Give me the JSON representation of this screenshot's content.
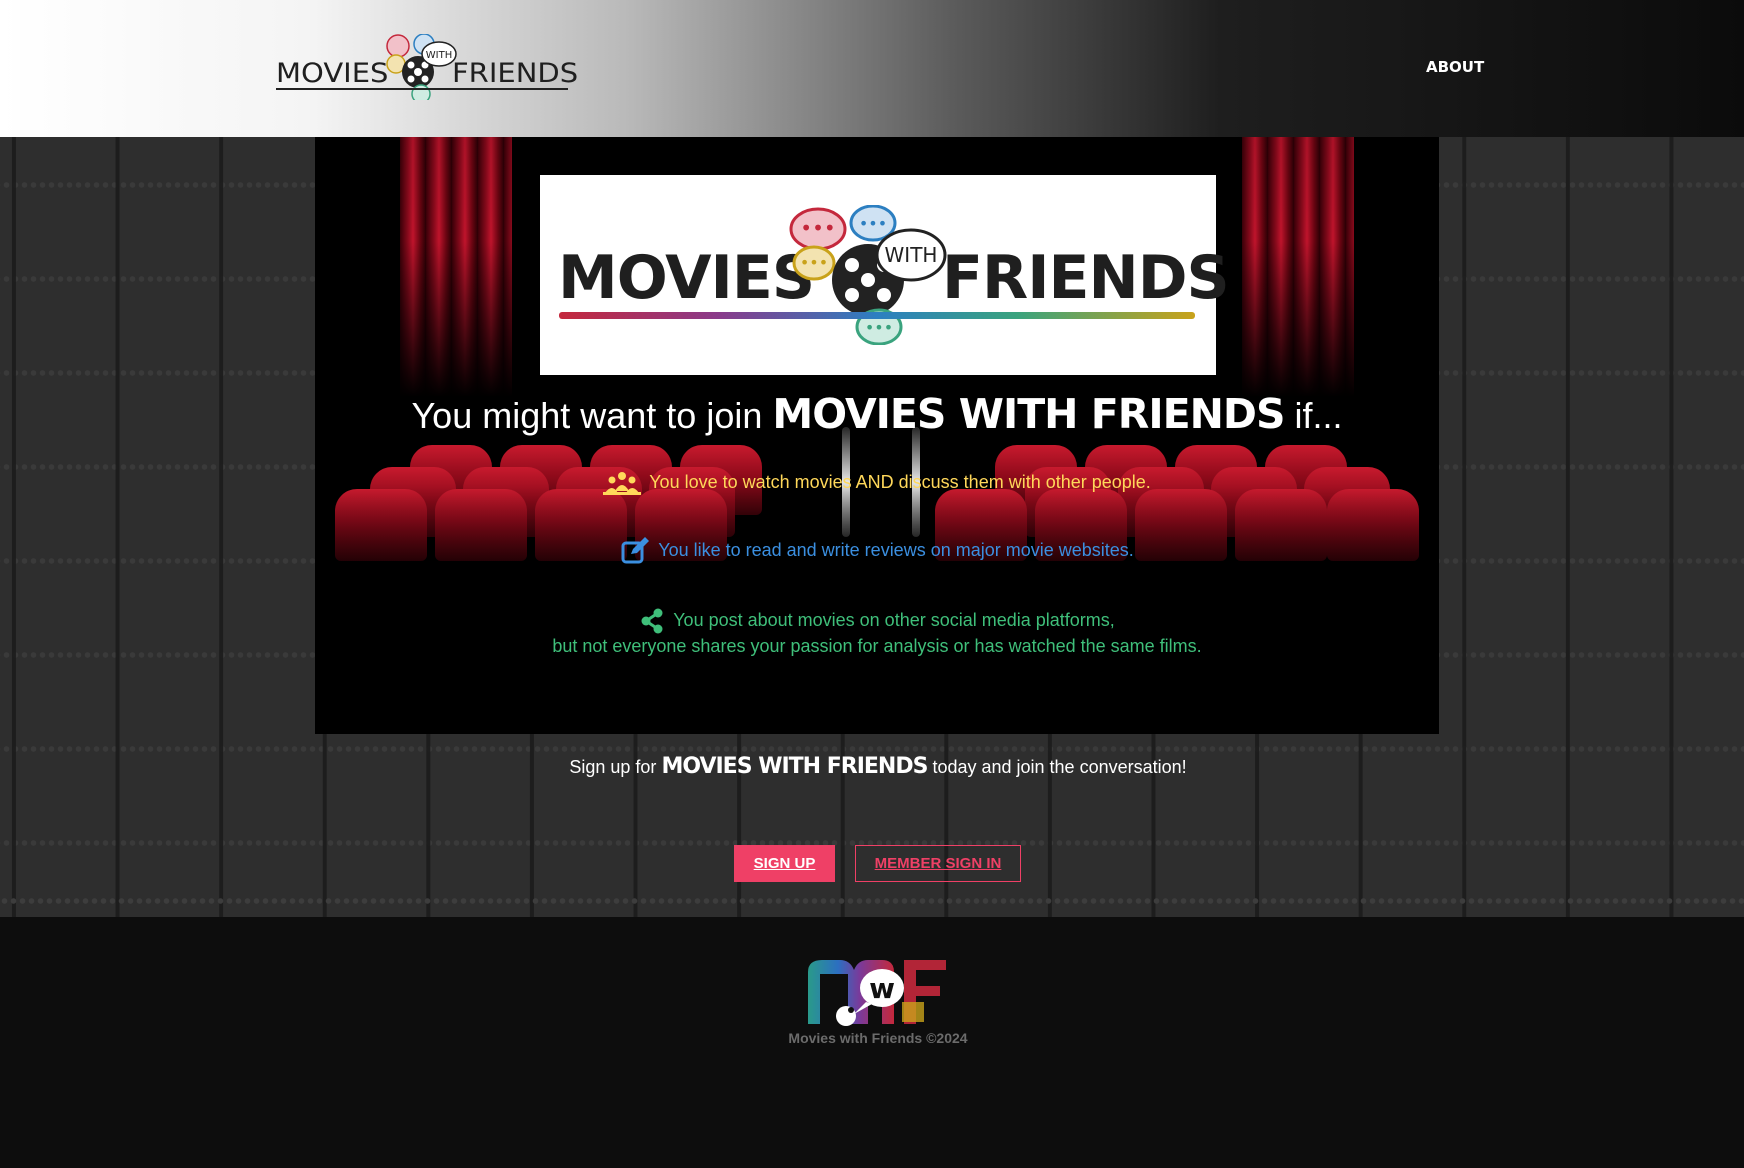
{
  "header": {
    "logo": {
      "word_left": "MOVIES",
      "word_mid": "WITH",
      "word_right": "FRIENDS"
    },
    "nav": {
      "about": "ABOUT"
    }
  },
  "hero": {
    "screen_logo": {
      "word_left": "MOVIES",
      "word_mid": "WITH",
      "word_right": "FRIENDS"
    },
    "headline": {
      "prefix": "You might want to join",
      "brand": "MOVIES WITH FRIENDS",
      "suffix": "if..."
    },
    "reasons": [
      {
        "icon": "group-icon",
        "color": "#ffd85a",
        "lines": [
          "You love to watch movies AND discuss them with other people."
        ]
      },
      {
        "icon": "edit-icon",
        "color": "#3b8fe0",
        "lines": [
          "You like to read and write reviews on major movie websites."
        ]
      },
      {
        "icon": "share-icon",
        "color": "#3fbf7a",
        "lines": [
          "You post about movies on other social media platforms,",
          "but not everyone shares your passion for analysis or has watched the same films."
        ]
      }
    ]
  },
  "cta": {
    "prefix": "Sign up for",
    "brand": "MOVIES WITH FRIENDS",
    "suffix": "today and join the conversation!",
    "signup_label": "SIGN UP",
    "signin_label": "MEMBER SIGN IN",
    "accent_color": "#ef4066"
  },
  "footer": {
    "logo_letters": "MWF",
    "copyright": "Movies with Friends ©2024"
  }
}
